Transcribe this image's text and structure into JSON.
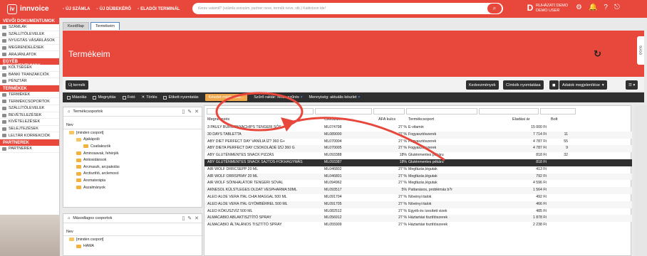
{
  "brand": {
    "name": "innvoice",
    "accent": "#e8473c",
    "dark": "#2f2f2f",
    "highlight": "#f0a84c"
  },
  "topnav": [
    "ÚJ SZÁMLA",
    "ÚJ DÍJBEKÉRŐ",
    "ELADÓI TERMINÁL"
  ],
  "search": {
    "placeholder": "Keres valamit? (számla sorszám, partner neve, termék neve, stb.) Kattintson ide!"
  },
  "user": {
    "initial": "D",
    "company": "RUHÁZATI DEMO",
    "role": "DEMO USER"
  },
  "sidebar": {
    "sections": [
      {
        "title": "VEVŐI DOKUMENTUMOK",
        "items": [
          "SZÁMLÁK",
          "SZÁLLÍTÓLEVELEK",
          "NYUGTÁS VÁSÁRLÁSOK",
          "MEGRENDELÉSEK",
          "ÁRAJÁNLATOK"
        ]
      },
      {
        "title": "EGYÉB DOKUMENTUMOK",
        "items": [
          "KÖLTSÉGEK",
          "BANKI TRANZAKCIÓK",
          "PÉNZTÁR"
        ]
      },
      {
        "title": "TERMÉKEK",
        "items": [
          "TERMÉKEK",
          "TERMÉKCSOPORTOK",
          "SZÁLLÍTÓLEVELEK",
          "BEVÉTELEZÉSEK",
          "KIVÉTELEZÉSEK",
          "SELEJTEZÉSEK",
          "LELTÁR KORREKCIÓK"
        ]
      },
      {
        "title": "PARTNEREK",
        "items": [
          "PARTNEREK"
        ]
      }
    ]
  },
  "tabs": [
    "Kezdőlap",
    "Termékeim"
  ],
  "page": {
    "title": "Termékeim",
    "side_tab": "SÚGÓ"
  },
  "actions": {
    "new": "Új termék",
    "discounts": "Kedvezmények",
    "labels": "Címkék nyomtatása",
    "display": "Adatok megjelenítése"
  },
  "toolbar": {
    "items": [
      "Másolás",
      "Megnyitás",
      "Fotó",
      "Törlés",
      "Etikett nyomtatás",
      "Készlet módosítás...",
      "Szűrő raktár: nincs szűrés",
      "Mennyiség: aktuális készlet"
    ]
  },
  "groups_panel": {
    "title": "Termékcsoportok",
    "col": "Nev",
    "rows": [
      {
        "label": "[minden csoport]",
        "level": 0
      },
      {
        "label": "Ajakápoló",
        "level": 1
      },
      {
        "label": "Csatlakozók",
        "level": 2
      },
      {
        "label": "Aminosavak, fehérjék",
        "level": 1
      },
      {
        "label": "Antioxidánsok",
        "level": 1
      },
      {
        "label": "Arcmaszk, arcpakolás",
        "level": 1
      },
      {
        "label": "Arctisztító, arclemosó",
        "level": 1
      },
      {
        "label": "Aromaterápia",
        "level": 1
      },
      {
        "label": "Aszalmányok",
        "level": 1
      }
    ]
  },
  "secondary_panel": {
    "title": "Másodlagos csoportok",
    "col": "Nev",
    "rows": [
      {
        "label": "[minden csoport]",
        "level": 0
      },
      {
        "label": "HAMA",
        "level": 1
      }
    ]
  },
  "grid": {
    "headers": [
      "Megnevezés",
      "Cikkszám",
      "ÁFA kulcs",
      "Termékcsoport",
      "Eladási ár",
      "Bolt"
    ],
    "rows": [
      [
        "3 PAULY BURGONYACHIPS TENGERI SÓS",
        "ML074798",
        "27 %",
        "E-vitamin",
        "15 000 Ft",
        ""
      ],
      [
        "30 DAYS TABLETTA",
        "ML089000",
        "27 %",
        "Fogyasztószerek",
        "7 714 Ft",
        "11"
      ],
      [
        "ABY DIET PERFECT DAY VANÍLIA ÍZ? 360 G+",
        "ML070004",
        "27 %",
        "Fogyasztószerek",
        "4 787 Ft",
        "55"
      ],
      [
        "ABY DIETA PERFECT DAY CSOKOLÁDÉ ÍZŰ 360 G",
        "ML070005",
        "27 %",
        "Fogyasztószerek",
        "4 787 Ft",
        "9"
      ],
      [
        "ABY GLUTÉNMENTES SNACK PIZZÁS",
        "ML093388",
        "18%",
        "Gluténmentes pékáru",
        "818 Ft",
        "32"
      ],
      [
        "ABY GLUTÉNMENTES SNACK SAJTOS-FOKHAGYMÁS",
        "ML093387",
        "18%",
        "Gluténmentes pékáru",
        "818 Ft",
        ""
      ],
      [
        "AIR WOLF DRRCSEPP 20 ML",
        "ML046802",
        "27 %",
        "Megfázás,légutak",
        "413 Ft",
        ""
      ],
      [
        "AIR WOLF ORRSPRAY 20 ML",
        "ML046801",
        "27 %",
        "Megfázás,légutak",
        "792 Ft",
        ""
      ],
      [
        "AIR WOLF SÓINHALÁTOR TENGERI SÓVAL",
        "ML094962",
        "27 %",
        "Megfázás,légutak",
        "4 596 Ft",
        ""
      ],
      [
        "AKNESOL KÜLS?LEGES OLDAT VESPHARMA 50ML",
        "ML093517",
        "5%",
        "Pattanásos, problémás b?r",
        "1 564 Ft",
        ""
      ],
      [
        "ALEO ALOE VERA ITAL CHIA MAGGAL 500 ML",
        "ML091704",
        "27 %",
        "Növényi italok",
        "492 Ft",
        ""
      ],
      [
        "ALEO ALOE VERA ITAL GYÖMBÉRREL 500 ML",
        "ML091705",
        "27 %",
        "Növényi italok",
        "466 Ft",
        ""
      ],
      [
        "ALEO KÓKUSZVÍZ 500 ML",
        "ML082512",
        "27 %",
        "Egyéb és ízesített vizek",
        "485 Ft",
        ""
      ],
      [
        "ALMACABIO ABLAKTISZTÍTÓ SPRAY",
        "ML056912",
        "27 %",
        "Háztartási tisztítószerek",
        "1 878 Ft",
        ""
      ],
      [
        "ALMACABIO ÁLTALÁNOS TISZTÍTÓ SPRAY",
        "ML055909",
        "27 %",
        "Háztartási tisztítószerek",
        "2 238 Ft",
        ""
      ]
    ],
    "selected_row": 5
  }
}
